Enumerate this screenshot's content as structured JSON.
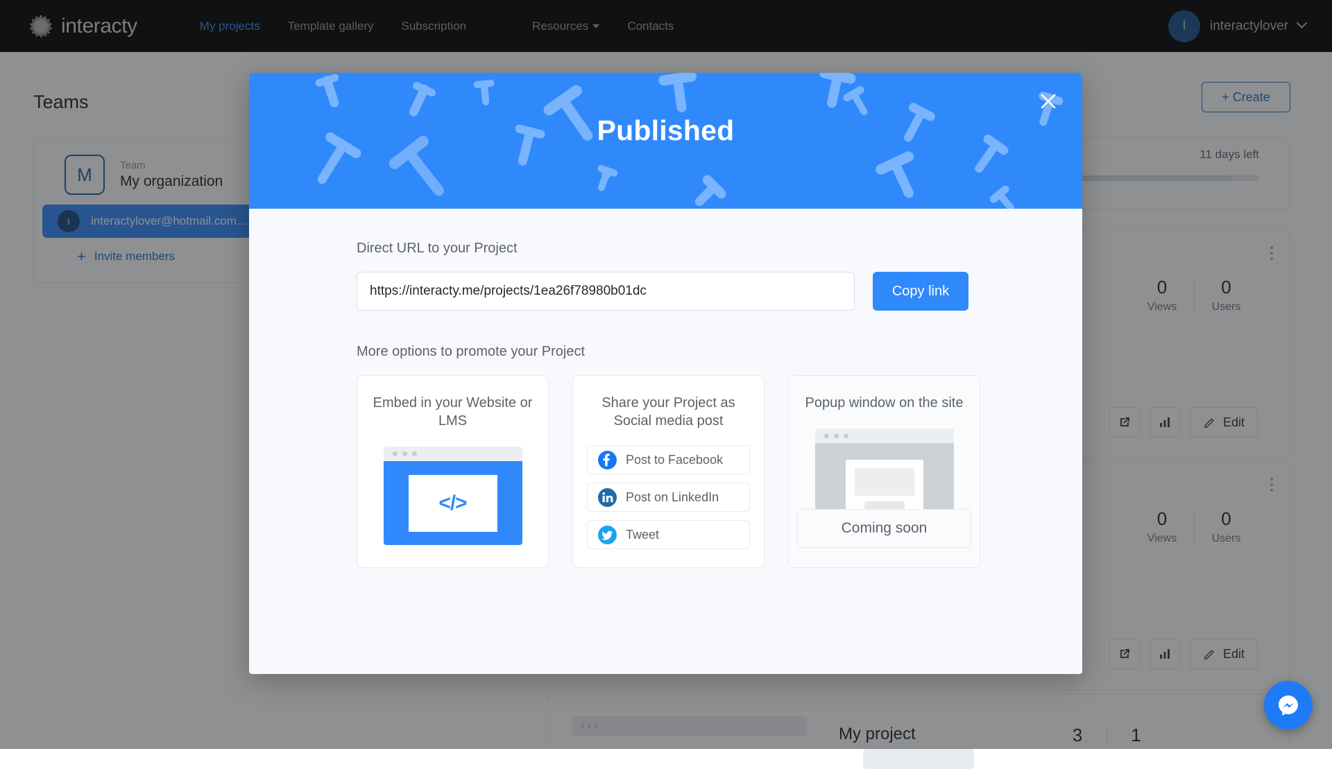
{
  "topnav": {
    "logo_text": "interacty",
    "logo_icon": "sunburst-logo-icon",
    "links": [
      {
        "label": "My projects",
        "active": true
      },
      {
        "label": "Template gallery",
        "active": false
      },
      {
        "label": "Subscription",
        "active": false
      },
      {
        "label": "Resources",
        "active": false,
        "caret": true
      },
      {
        "label": "Contacts",
        "active": false
      }
    ],
    "user": {
      "avatar_initial": "I",
      "name": "interactylover",
      "caret_icon": "chevron-down-icon"
    }
  },
  "page": {
    "teams_heading": "Teams",
    "create_button": "+ Create",
    "team": {
      "badge_initial": "M",
      "label": "Team",
      "name": "My organization",
      "member_avatar_initial": "I",
      "member_email": "interactylover@hotmail.com…",
      "invite_label": "Invite members",
      "invite_icon": "plus-icon"
    },
    "plan": {
      "days_left": "11 days left"
    },
    "projects": [
      {
        "views": "0",
        "views_caption": "Views",
        "users": "0",
        "users_caption": "Users",
        "edit_label": "Edit",
        "open_icon": "open-external-icon",
        "stats_icon": "bar-chart-icon",
        "edit_icon": "pencil-icon",
        "menu_icon": "kebab-menu-icon"
      },
      {
        "views": "0",
        "views_caption": "Views",
        "users": "0",
        "users_caption": "Users",
        "edit_label": "Edit",
        "open_icon": "open-external-icon",
        "stats_icon": "bar-chart-icon",
        "edit_icon": "pencil-icon",
        "menu_icon": "kebab-menu-icon"
      }
    ],
    "bottom_project": {
      "title": "My project",
      "views": "3",
      "users": "1"
    },
    "messenger_icon": "facebook-messenger-icon"
  },
  "modal": {
    "title": "Published",
    "close_icon": "close-icon",
    "url_label": "Direct URL to your Project",
    "url_value": "https://interacty.me/projects/1ea26f78980b01dc",
    "url_placeholder": "https://interacty.me/projects/",
    "copy_button": "Copy link",
    "more_options_label": "More options to promote your Project",
    "cards": [
      {
        "title": "Embed in your Website or LMS",
        "mock_icon": "code-embed-icon",
        "code_glyph": "</>"
      },
      {
        "title": "Share your Project as Social media post",
        "buttons": [
          {
            "label": "Post to Facebook",
            "icon": "facebook-icon",
            "color": "#1877f2"
          },
          {
            "label": "Post on LinkedIn",
            "icon": "linkedin-icon",
            "color": "#1f6aa8"
          },
          {
            "label": "Tweet",
            "icon": "twitter-icon",
            "color": "#1da1f2"
          }
        ]
      },
      {
        "title": "Popup window on the site",
        "mock_icon": "popup-window-icon",
        "coming_soon": "Coming soon"
      }
    ]
  },
  "colors": {
    "brand_blue": "#3089fb",
    "header_blue": "#3089fb",
    "nav_black": "#000000",
    "scrim": "rgba(31,33,36,0.50)"
  }
}
